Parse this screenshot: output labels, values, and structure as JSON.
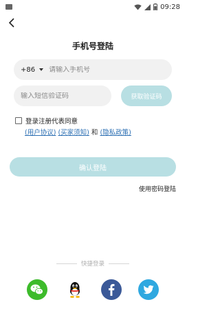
{
  "status_bar": {
    "time": "09:28"
  },
  "page": {
    "title": "手机号登陆"
  },
  "phone": {
    "country_code": "+86",
    "placeholder": "请输入手机号"
  },
  "sms": {
    "placeholder": "输入短信验证码",
    "get_code_label": "获取验证码"
  },
  "agreement": {
    "text": "登录注册代表同意",
    "user_agreement": "(用户协议)",
    "buyer_notice": "(买家须知)",
    "and": "和",
    "privacy_policy": "(隐私政策)"
  },
  "actions": {
    "confirm_label": "确认登陆",
    "password_login": "使用密码登陆"
  },
  "quick_login": {
    "label": "快捷登录",
    "icons": [
      "wechat-icon",
      "qq-icon",
      "facebook-icon",
      "twitter-icon"
    ]
  },
  "colors": {
    "accent_disabled": "#b8dfe3",
    "link": "#2c6fb3",
    "input_bg": "#f1f1f1"
  }
}
